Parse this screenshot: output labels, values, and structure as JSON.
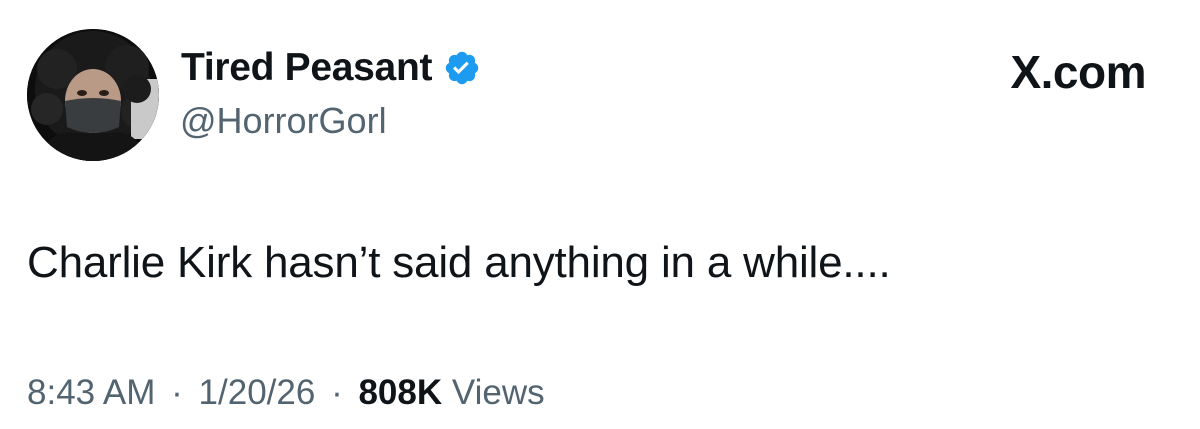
{
  "author": {
    "display_name": "Tired Peasant",
    "handle": "@HorrorGorl",
    "verified": true,
    "avatar": "avatar-photo"
  },
  "brand": {
    "label": "X.com"
  },
  "tweet": {
    "text": "Charlie Kirk hasn’t said anything in a while...."
  },
  "meta": {
    "time": "8:43 AM",
    "separator": "·",
    "date": "1/20/26",
    "views_count": "808K",
    "views_label": "Views"
  },
  "colors": {
    "text_primary": "#0f1419",
    "text_secondary": "#536471",
    "verified_blue": "#1d9bf0",
    "background": "#ffffff"
  },
  "icons": {
    "verified": "verified-badge-icon"
  }
}
